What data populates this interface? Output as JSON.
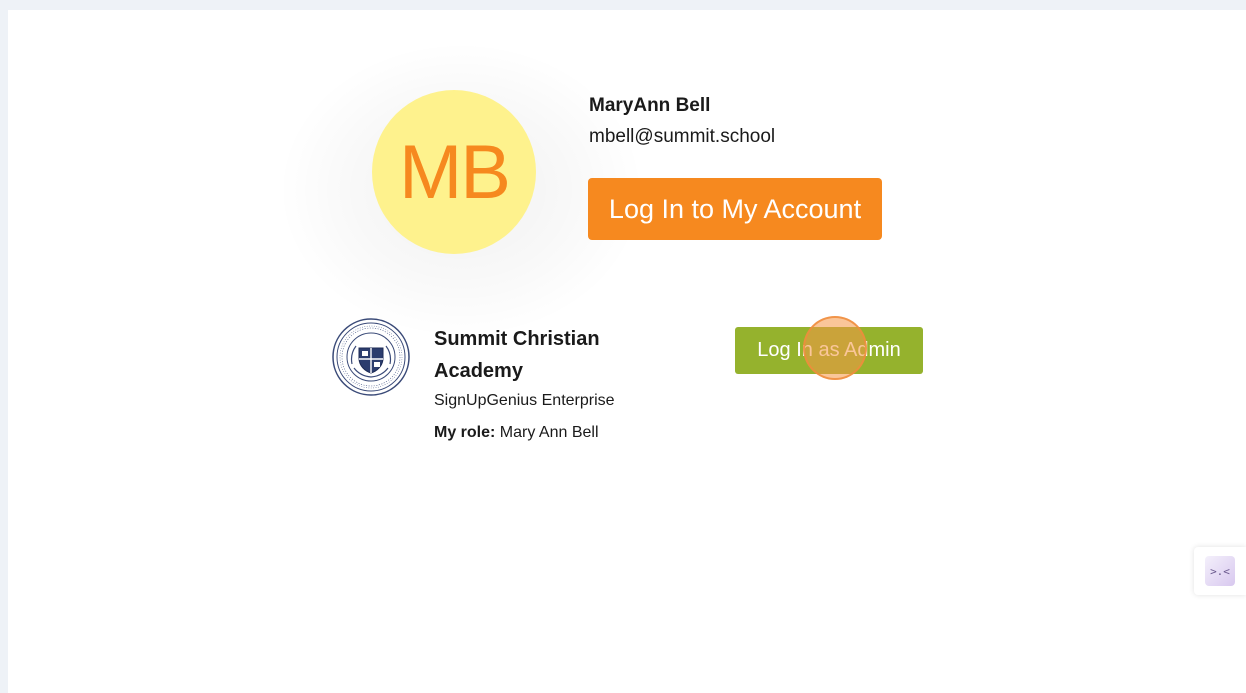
{
  "user": {
    "initials": "MB",
    "name": "MaryAnn Bell",
    "email": "mbell@summit.school",
    "login_label": "Log In to My Account",
    "avatar_bg": "#fef28d",
    "avatar_fg": "#f6891f"
  },
  "organization": {
    "name": "Summit Christian Academy",
    "plan": "SignUpGenius Enterprise",
    "role_label": "My role:",
    "role_value": "Mary Ann Bell",
    "admin_login_label": "Log In as Admin",
    "seal_icon": "school-seal-icon"
  },
  "side_widget": {
    "icon": "face-icon",
    "glyph": ">.<"
  },
  "colors": {
    "accent_orange": "#f6891f",
    "accent_green": "#95b22d",
    "page_bg": "#eef2f7"
  }
}
